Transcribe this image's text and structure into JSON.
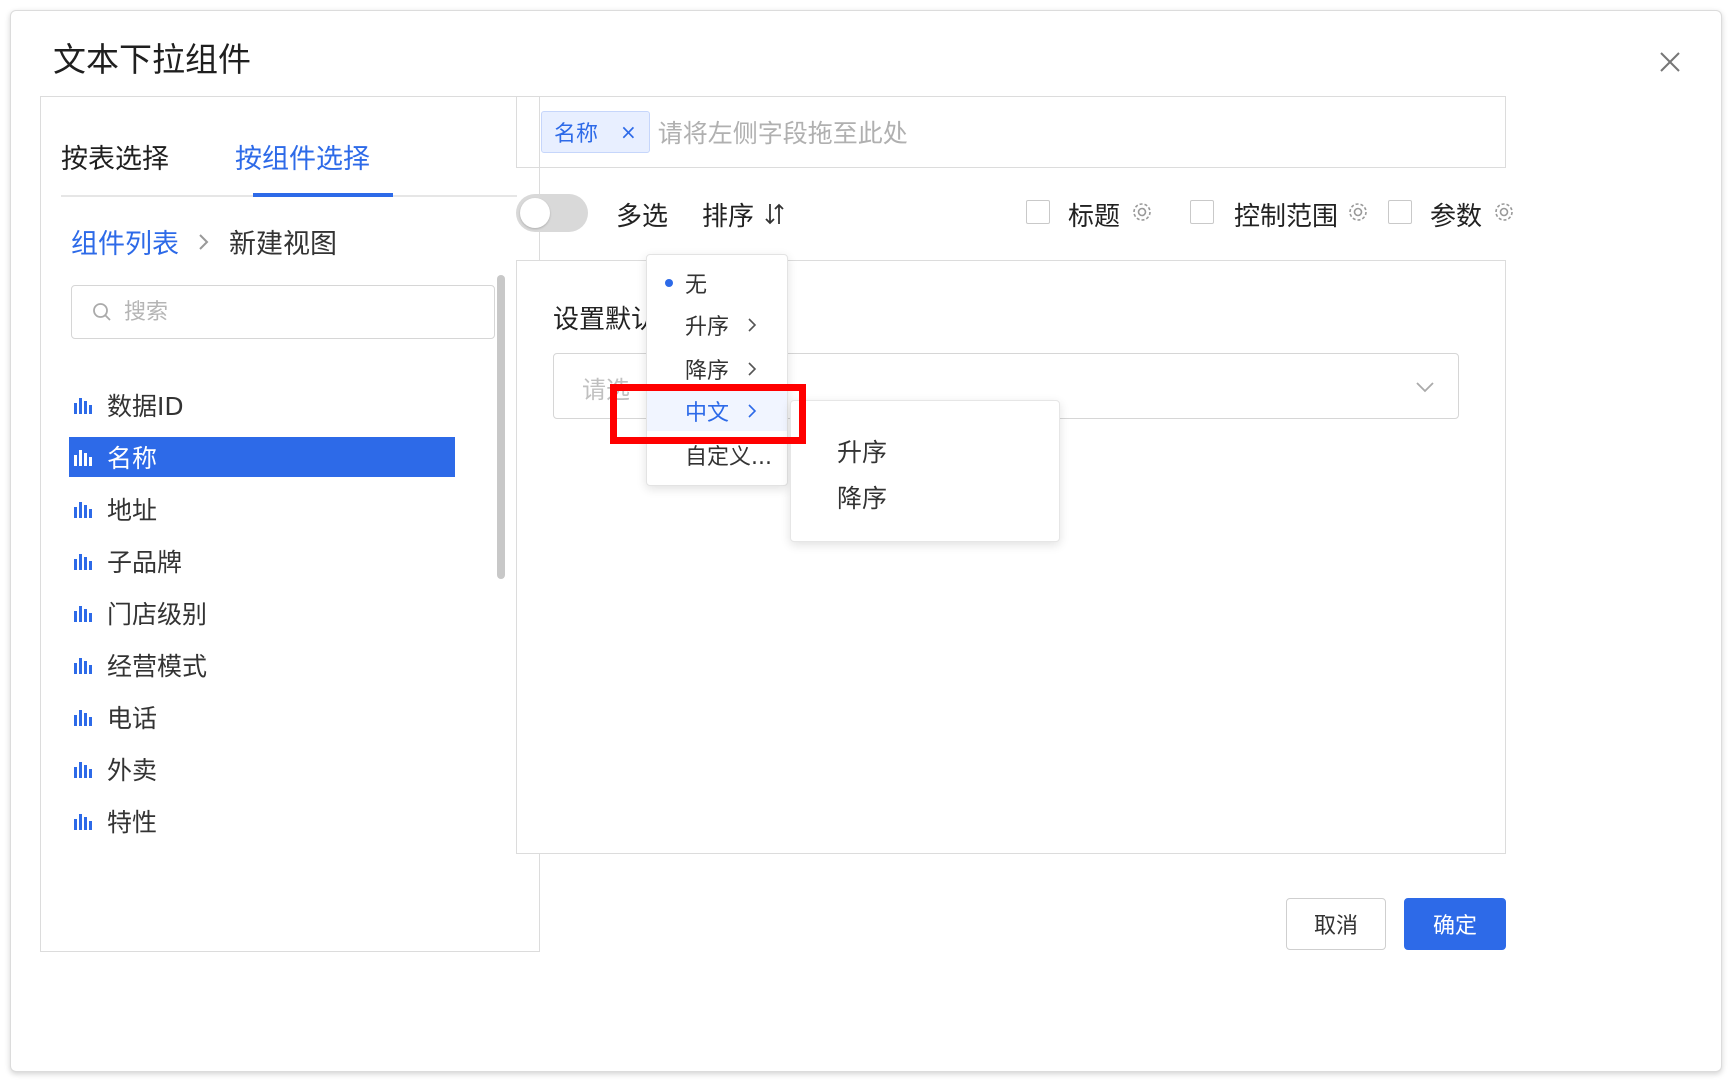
{
  "dialog": {
    "title": "文本下拉组件"
  },
  "left": {
    "tabs": [
      {
        "label": "按表选择"
      },
      {
        "label": "按组件选择"
      }
    ],
    "breadcrumb": {
      "link": "组件列表",
      "current": "新建视图"
    },
    "search": {
      "placeholder": "搜索"
    },
    "fields": [
      {
        "label": "数据ID"
      },
      {
        "label": "名称"
      },
      {
        "label": "地址"
      },
      {
        "label": "子品牌"
      },
      {
        "label": "门店级别"
      },
      {
        "label": "经营模式"
      },
      {
        "label": "电话"
      },
      {
        "label": "外卖"
      },
      {
        "label": "特性"
      }
    ]
  },
  "dropzone": {
    "tag": "名称",
    "tag_close": "×",
    "hint": "请将左侧字段拖至此处"
  },
  "toolbar": {
    "multi_label": "多选",
    "sort_label": "排序",
    "title_label": "标题",
    "scope_label": "控制范围",
    "params_label": "参数"
  },
  "content": {
    "default_label": "设置默认",
    "select_placeholder": "请选"
  },
  "sort_menu": {
    "items": [
      {
        "label": "无"
      },
      {
        "label": "升序"
      },
      {
        "label": "降序"
      },
      {
        "label": "中文"
      },
      {
        "label": "自定义..."
      }
    ],
    "submenu": [
      {
        "label": "升序"
      },
      {
        "label": "降序"
      }
    ]
  },
  "footer": {
    "cancel": "取消",
    "ok": "确定"
  },
  "colors": {
    "accent": "#2d6ae8",
    "highlight": "#ff0000"
  }
}
